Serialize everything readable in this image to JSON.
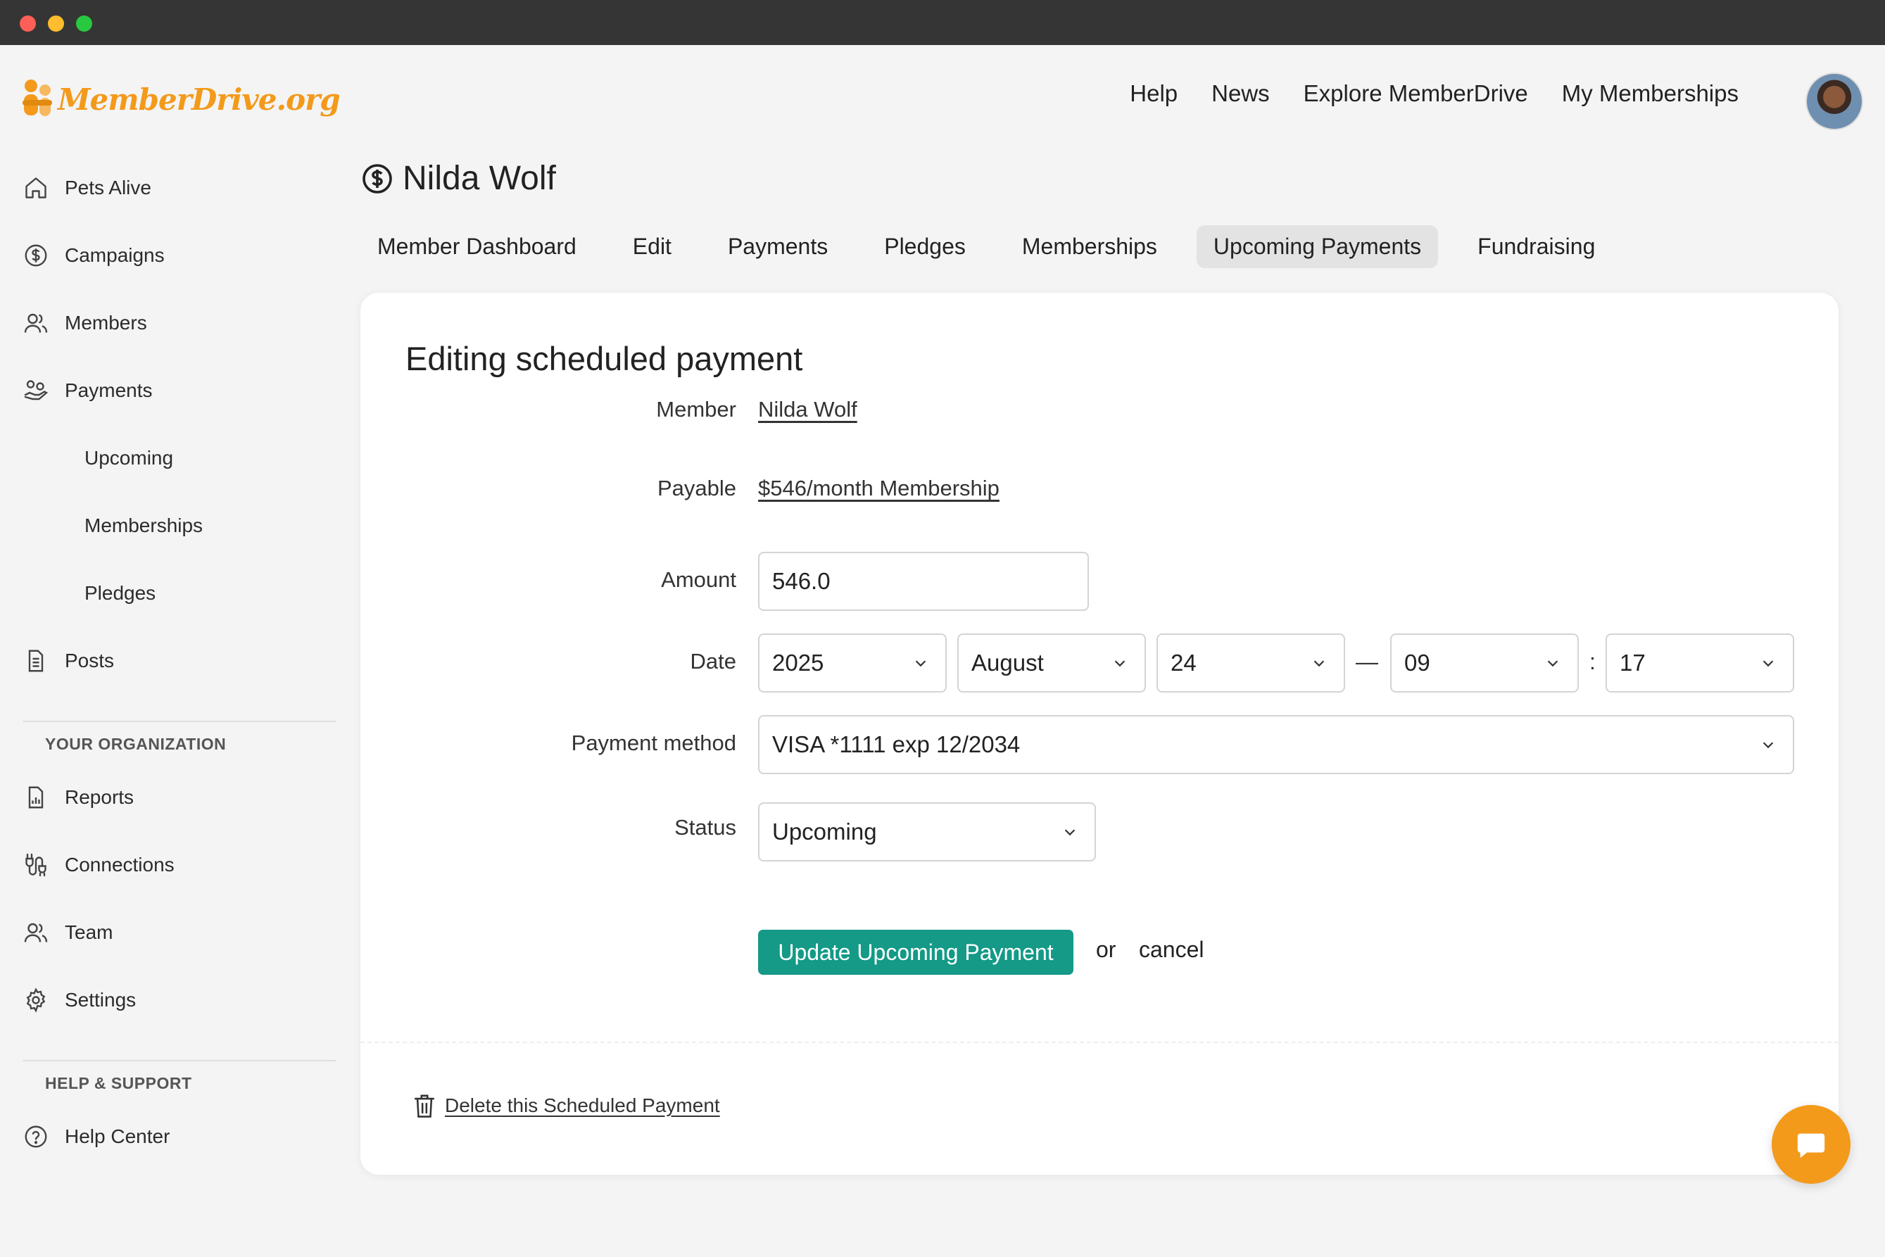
{
  "header": {
    "logo_text": "MemberDrive.org",
    "nav": [
      "Help",
      "News",
      "Explore MemberDrive",
      "My Memberships"
    ]
  },
  "sidebar": {
    "items": [
      {
        "label": "Pets Alive",
        "icon": "home-icon"
      },
      {
        "label": "Campaigns",
        "icon": "dollar-circle-icon"
      },
      {
        "label": "Members",
        "icon": "users-icon"
      },
      {
        "label": "Payments",
        "icon": "hand-coins-icon"
      },
      {
        "label": "Upcoming"
      },
      {
        "label": "Memberships"
      },
      {
        "label": "Pledges"
      },
      {
        "label": "Posts",
        "icon": "document-icon"
      }
    ],
    "org_section_title": "YOUR ORGANIZATION",
    "org_items": [
      {
        "label": "Reports",
        "icon": "report-icon"
      },
      {
        "label": "Connections",
        "icon": "plug-icon"
      },
      {
        "label": "Team",
        "icon": "users-icon"
      },
      {
        "label": "Settings",
        "icon": "gear-icon"
      }
    ],
    "help_section_title": "HELP & SUPPORT",
    "help_items": [
      {
        "label": "Help Center",
        "icon": "question-circle-icon"
      }
    ]
  },
  "member": {
    "name": "Nilda Wolf"
  },
  "tabs": [
    {
      "label": "Member Dashboard"
    },
    {
      "label": "Edit"
    },
    {
      "label": "Payments"
    },
    {
      "label": "Pledges"
    },
    {
      "label": "Memberships"
    },
    {
      "label": "Upcoming Payments",
      "active": true
    },
    {
      "label": "Fundraising"
    }
  ],
  "form": {
    "title": "Editing scheduled payment",
    "member_label": "Member",
    "member_value": "Nilda Wolf",
    "payable_label": "Payable",
    "payable_value": "$546/month Membership",
    "amount_label": "Amount",
    "amount_value": "546.0",
    "date_label": "Date",
    "date_year": "2025",
    "date_month": "August",
    "date_day": "24",
    "date_dash": "—",
    "time_hour": "09",
    "time_colon": ":",
    "time_minute": "17",
    "payment_method_label": "Payment method",
    "payment_method_value": "VISA *1111 exp 12/2034",
    "status_label": "Status",
    "status_value": "Upcoming",
    "submit_label": "Update Upcoming Payment",
    "or_text": "or",
    "cancel_label": "cancel",
    "delete_label": "Delete this Scheduled Payment"
  },
  "colors": {
    "brand": "#f39a1b",
    "primary_button": "#149a87",
    "titlebar": "#353535"
  }
}
